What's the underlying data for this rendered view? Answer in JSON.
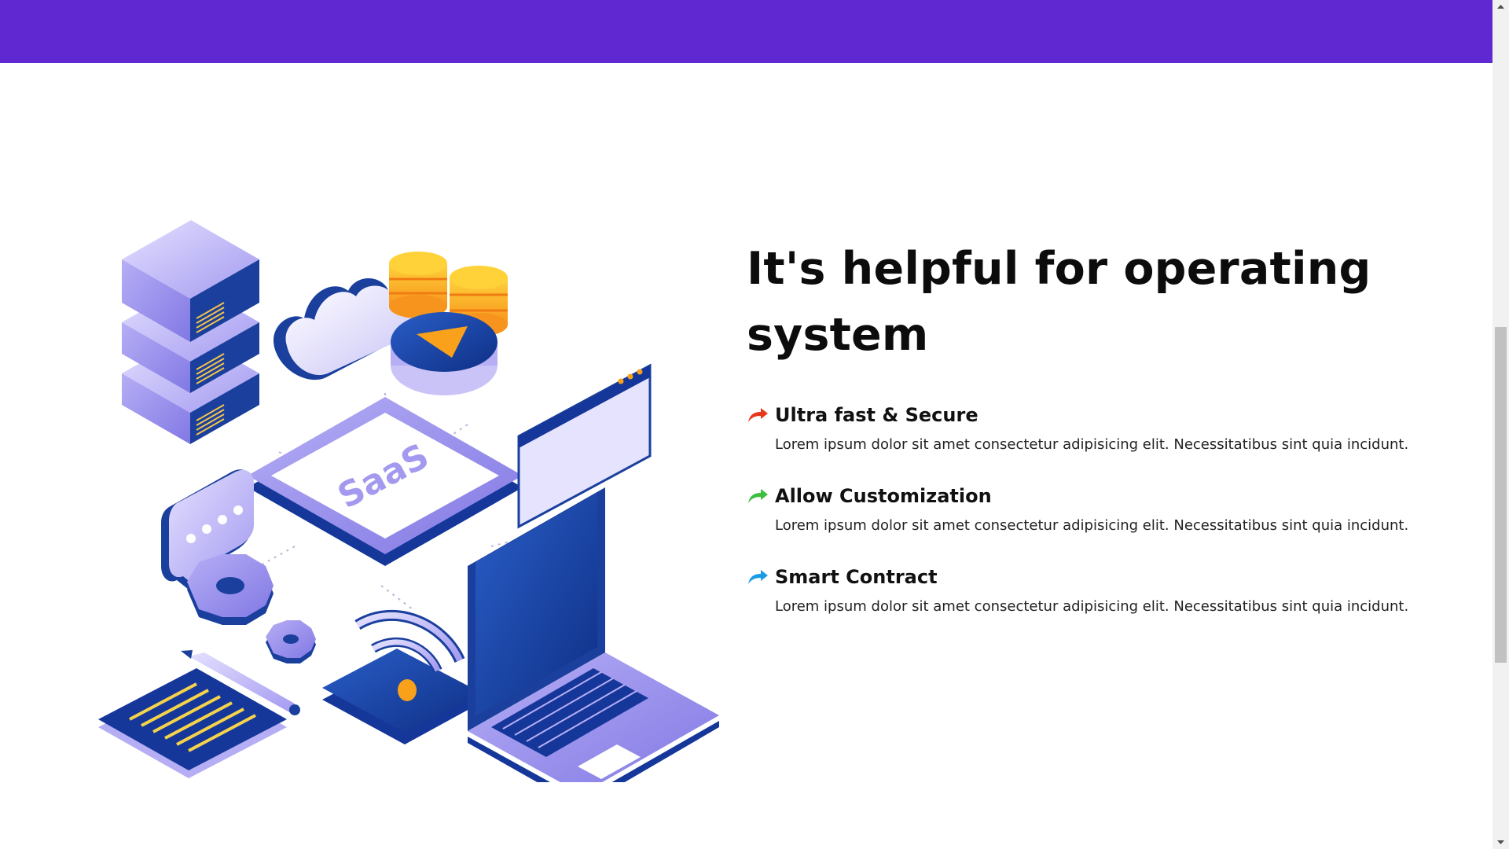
{
  "section": {
    "headline": "It's helpful for operating system",
    "illustration_label": "SaaS",
    "features": [
      {
        "title": "Ultra fast & Secure",
        "description": "Lorem ipsum dolor sit amet consectetur adipisicing elit. Necessitatibus sint quia incidunt.",
        "icon": "curved-arrow-icon",
        "color": "#e8381b"
      },
      {
        "title": "Allow Customization",
        "description": "Lorem ipsum dolor sit amet consectetur adipisicing elit. Necessitatibus sint quia incidunt.",
        "icon": "curved-arrow-icon",
        "color": "#3cbf3c"
      },
      {
        "title": "Smart Contract",
        "description": "Lorem ipsum dolor sit amet consectetur adipisicing elit. Necessitatibus sint quia incidunt.",
        "icon": "curved-arrow-icon",
        "color": "#1a9be6"
      }
    ]
  },
  "theme": {
    "header_color": "#6028d0",
    "illustration_primary": "#1a3f9c",
    "illustration_light": "#b8b0f5",
    "coin_color": "#f9a11b"
  },
  "scrollbar": {
    "position": 0.55
  }
}
